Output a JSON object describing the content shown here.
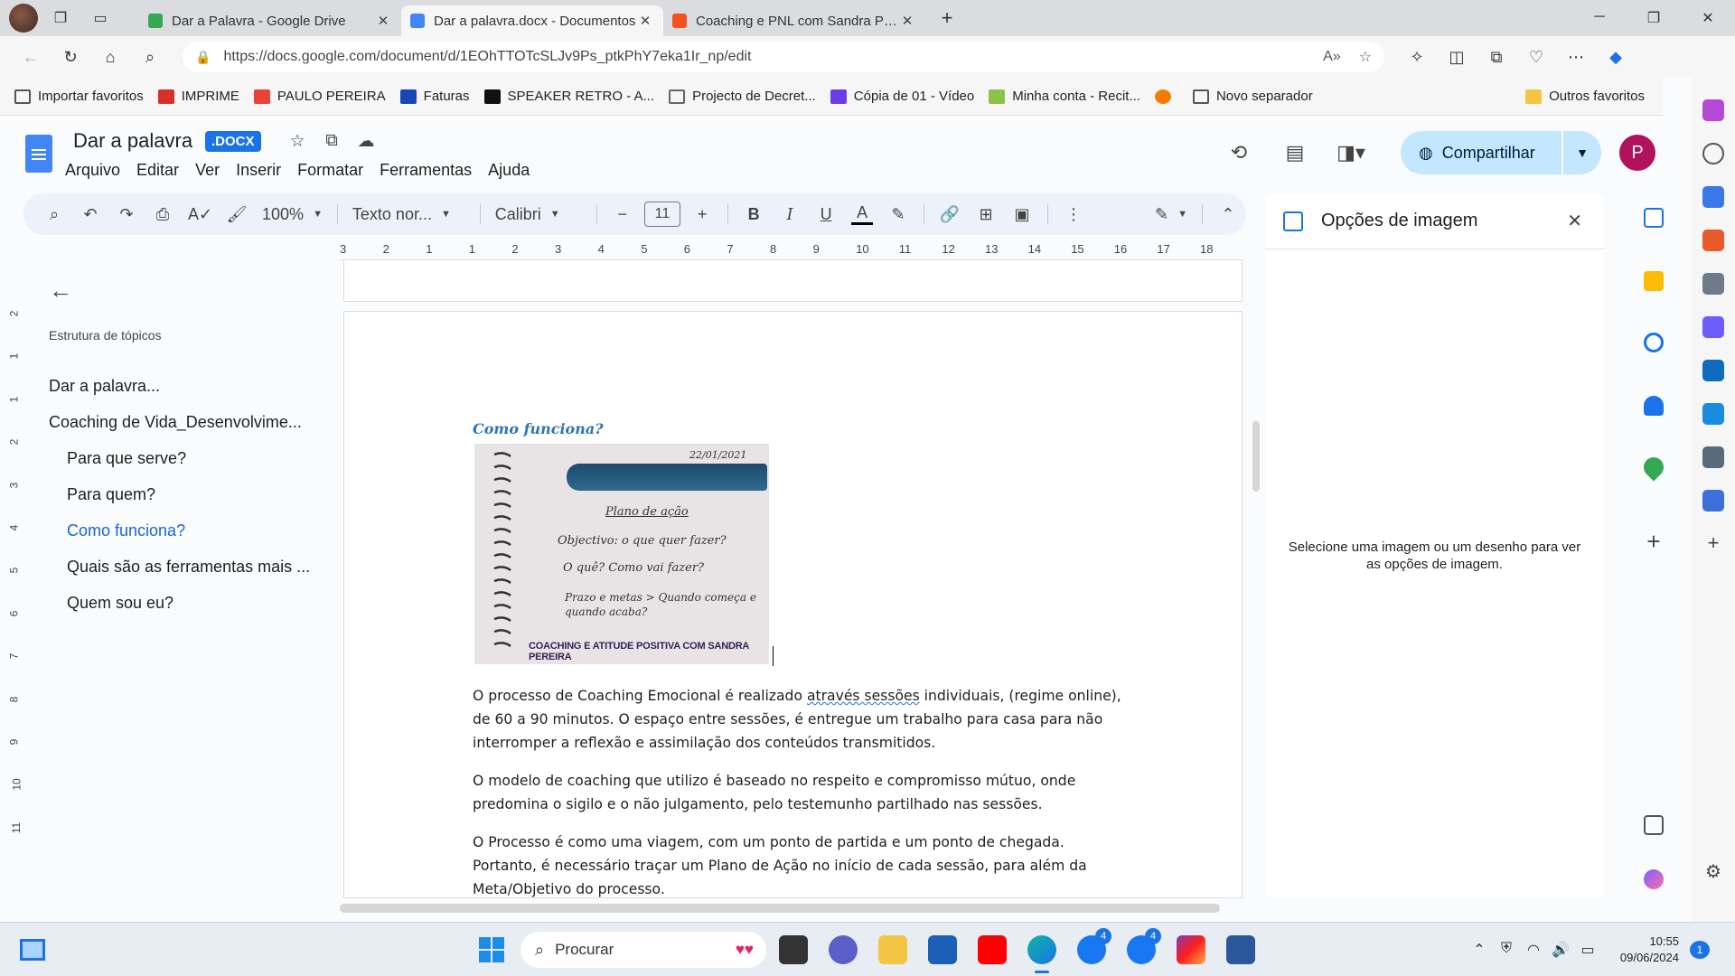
{
  "browser": {
    "tabs": [
      {
        "title": "Dar a Palavra - Google Drive",
        "color": "#34a853"
      },
      {
        "title": "Dar a palavra.docx - Documentos",
        "color": "#4285f4",
        "active": true
      },
      {
        "title": "Coaching e PNL com Sandra Pereira",
        "color": "#f4511e"
      }
    ],
    "url": "https://docs.google.com/document/d/1EOhTTOTcSLJv9Ps_ptkPhY7eka1Ir_np/edit",
    "bookmarks": [
      {
        "label": "Importar favoritos",
        "color": "#555555"
      },
      {
        "label": "IMPRIME",
        "color": "#d93025"
      },
      {
        "label": "PAULO PEREIRA",
        "color": "#ea4335"
      },
      {
        "label": "Faturas",
        "color": "#1a47b8"
      },
      {
        "label": "SPEAKER RETRO - A...",
        "color": "#111111"
      },
      {
        "label": "Projecto de Decret...",
        "color": "#666666"
      },
      {
        "label": "Cópia de 01 - Vídeo",
        "color": "#6a3de8"
      },
      {
        "label": "Minha conta - Recit...",
        "color": "#8bc34a"
      },
      {
        "label": "",
        "color": "#f57c00"
      },
      {
        "label": "Novo separador",
        "color": "#555555"
      }
    ],
    "other_bookmarks": "Outros favoritos"
  },
  "doc": {
    "title": "Dar a palavra",
    "badge": ".DOCX",
    "menu": [
      "Arquivo",
      "Editar",
      "Ver",
      "Inserir",
      "Formatar",
      "Ferramentas",
      "Ajuda"
    ],
    "share_label": "Compartilhar",
    "user_initial": "P",
    "toolbar": {
      "zoom": "100%",
      "style": "Texto nor...",
      "font": "Calibri",
      "font_size": "11"
    },
    "ruler": [
      "3",
      "2",
      "1",
      "1",
      "2",
      "3",
      "4",
      "5",
      "6",
      "7",
      "8",
      "9",
      "10",
      "11",
      "12",
      "13",
      "14",
      "15",
      "16",
      "17",
      "18"
    ],
    "vruler": [
      "2",
      "1",
      "1",
      "2",
      "3",
      "4",
      "5",
      "6",
      "7",
      "8",
      "9",
      "10",
      "11"
    ]
  },
  "outline": {
    "heading": "Estrutura de tópicos",
    "items": [
      {
        "label": "Dar a palavra...",
        "level": 1
      },
      {
        "label": "Coaching de Vida_Desenvolvime...",
        "level": 1
      },
      {
        "label": "Para que serve?",
        "level": 2
      },
      {
        "label": "Para quem?",
        "level": 2
      },
      {
        "label": "Como funciona?",
        "level": 2,
        "active": true
      },
      {
        "label": "Quais são as ferramentas mais ...",
        "level": 2
      },
      {
        "label": "Quem sou eu?",
        "level": 2
      }
    ]
  },
  "content": {
    "heading": "Como funciona?",
    "image": {
      "date": "22/01/2021",
      "handwritten": [
        "Plano de ação",
        "Objectivo: o que quer fazer?",
        "O quê?   Como vai fazer?",
        "Prazo e metas  >  Quando começa e quando acaba?"
      ],
      "caption": "COACHING E ATITUDE POSITIVA COM SANDRA PEREIRA"
    },
    "p1_before": " O processo de Coaching Emocional é realizado ",
    "p1_squiggle": "através sessões",
    "p1_after": " individuais, (regime online), de 60 a 90 minutos. O espaço entre sessões, é entregue um trabalho para casa para não interromper a reflexão e assimilação dos conteúdos transmitidos.",
    "p2": "O modelo de coaching que utilizo é baseado no respeito e compromisso mútuo, onde predomina o sigilo e o não julgamento, pelo testemunho partilhado nas sessões.",
    "p3": " O Processo é como uma viagem, com um ponto de partida e um ponto de chegada. Portanto, é necessário traçar um Plano de Ação no início de cada sessão, para além da Meta/Objetivo do processo."
  },
  "image_panel": {
    "title": "Opções de imagem",
    "message": "Selecione uma imagem ou um desenho para ver as opções de imagem."
  },
  "taskbar": {
    "search": "Procurar",
    "time": "10:55",
    "date": "09/06/2024",
    "notifications": "1",
    "badges": {
      "fb1": "4",
      "fb2": "4"
    }
  }
}
